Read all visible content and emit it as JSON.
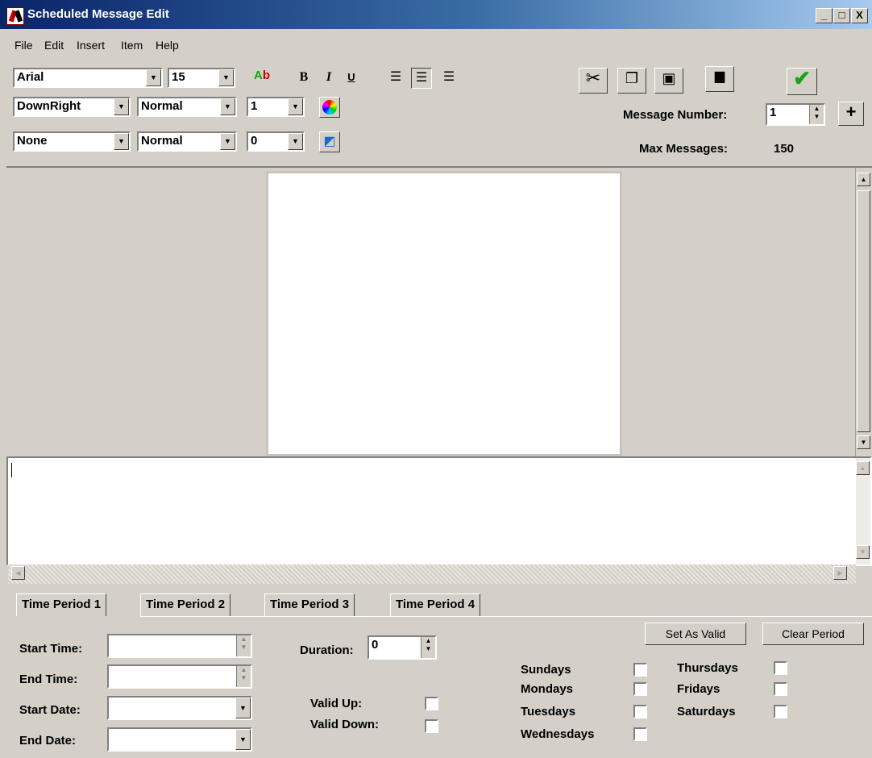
{
  "window": {
    "title": "Scheduled Message Edit",
    "minimize": "_",
    "maximize": "□",
    "close": "X"
  },
  "menu": [
    "File",
    "Edit",
    "Insert",
    "Item",
    "Help"
  ],
  "toolbar": {
    "font": "Arial",
    "font_size": "15",
    "effect": "DownRight",
    "style1": "Normal",
    "value1": "1",
    "border": "None",
    "style2": "Normal",
    "value2": "0",
    "bold": "B",
    "italic": "I",
    "underline": "U"
  },
  "message": {
    "number_label": "Message Number:",
    "number_value": "1",
    "max_label": "Max Messages:",
    "max_value": "150"
  },
  "tabs": [
    "Time Period 1",
    "Time Period 2",
    "Time Period 3",
    "Time Period 4"
  ],
  "period": {
    "start_time_label": "Start Time:",
    "end_time_label": "End Time:",
    "start_date_label": "Start Date:",
    "end_date_label": "End Date:",
    "duration_label": "Duration:",
    "duration_value": "0",
    "valid_up_label": "Valid Up:",
    "valid_down_label": "Valid Down:",
    "set_valid": "Set As Valid",
    "clear_period": "Clear Period",
    "days": [
      "Sundays",
      "Mondays",
      "Tuesdays",
      "Wednesdays",
      "Thursdays",
      "Fridays",
      "Saturdays"
    ]
  },
  "colors": {
    "face": "#d4d0c8",
    "title_start": "#0a246a",
    "title_end": "#a6caf0",
    "check_green": "#1aa31a"
  },
  "icons": [
    "app-icon",
    "font-color-icon",
    "color-wheel-icon",
    "fill-icon",
    "cut-icon",
    "copy-icon",
    "paste-icon",
    "camera-icon",
    "checkmark-icon",
    "plus-icon"
  ]
}
